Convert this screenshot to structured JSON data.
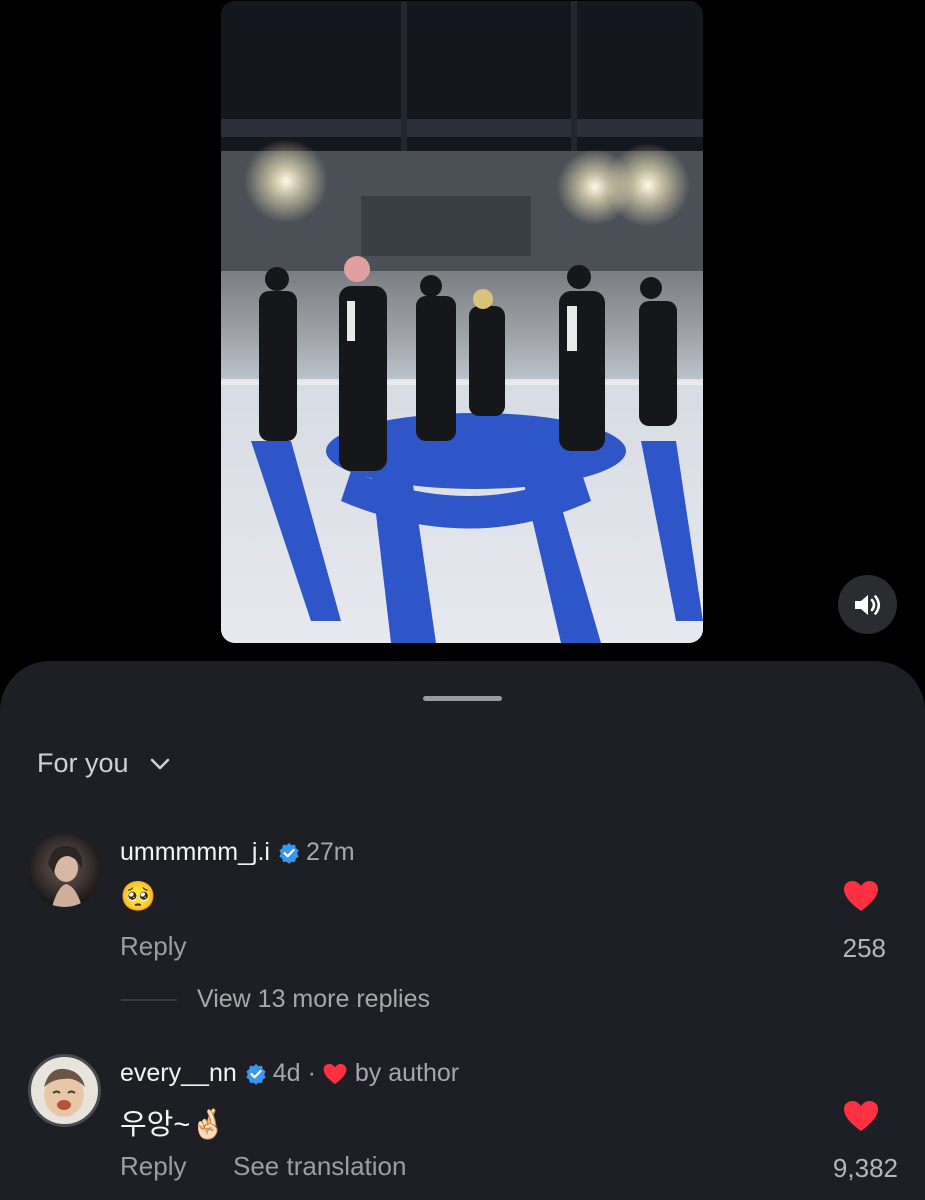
{
  "sheet": {
    "filter_label": "For you"
  },
  "comments": [
    {
      "username": "ummmmm_j.i",
      "time": "27m",
      "body": "🥺",
      "reply_label": "Reply",
      "likes": "258"
    },
    {
      "username": "every__nn",
      "time": "4d",
      "liked_by_author_label": "by author",
      "body": "우앙~🤞🏻",
      "reply_label": "Reply",
      "translate_label": "See translation",
      "likes": "9,382"
    }
  ],
  "view_more_replies": "View 13 more replies",
  "colors": {
    "sheet_bg": "#1e1f24",
    "heart_red": "#ff3040",
    "verified_blue": "#3897f0",
    "stage_blue": "#2f56c8"
  },
  "icons": {
    "sound": "speaker-icon",
    "filter": "chevron-down-icon",
    "verified": "verified-badge-icon",
    "like": "heart-icon"
  }
}
